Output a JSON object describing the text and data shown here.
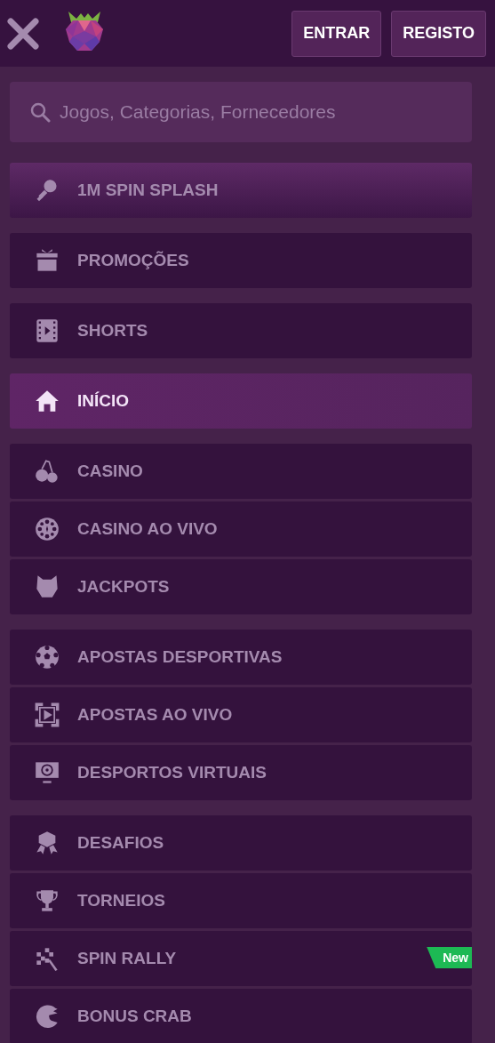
{
  "header": {
    "buttons": [
      "ENTRAR",
      "REGISTO"
    ]
  },
  "search": {
    "placeholder": "Jogos, Categorias, Fornecedores"
  },
  "menu_groups": [
    [
      {
        "kind": "banner",
        "label": "1M SPIN SPLASH",
        "selected": false
      }
    ],
    [
      {
        "kind": "item",
        "label": "PROMOÇÕES",
        "selected": false
      }
    ],
    [
      {
        "kind": "item",
        "label": "SHORTS",
        "selected": false
      }
    ],
    [
      {
        "kind": "item",
        "label": "INÍCIO",
        "selected": true
      }
    ],
    [
      {
        "kind": "item",
        "label": "CASINO",
        "selected": false
      },
      {
        "kind": "item",
        "label": "CASINO AO VIVO",
        "selected": false
      },
      {
        "kind": "item",
        "label": "JACKPOTS",
        "selected": false
      }
    ],
    [
      {
        "kind": "item",
        "label": "APOSTAS DESPORTIVAS",
        "selected": false
      },
      {
        "kind": "item",
        "label": "APOSTAS AO VIVO",
        "selected": false
      },
      {
        "kind": "item",
        "label": "DESPORTOS VIRTUAIS",
        "selected": false
      }
    ],
    [
      {
        "kind": "item",
        "label": "DESAFIOS",
        "selected": false
      },
      {
        "kind": "item",
        "label": "TORNEIOS",
        "selected": false
      },
      {
        "kind": "item",
        "label": "SPIN RALLY",
        "selected": false,
        "badge": "New"
      },
      {
        "kind": "item",
        "label": "BONUS CRAB",
        "selected": false
      }
    ]
  ]
}
